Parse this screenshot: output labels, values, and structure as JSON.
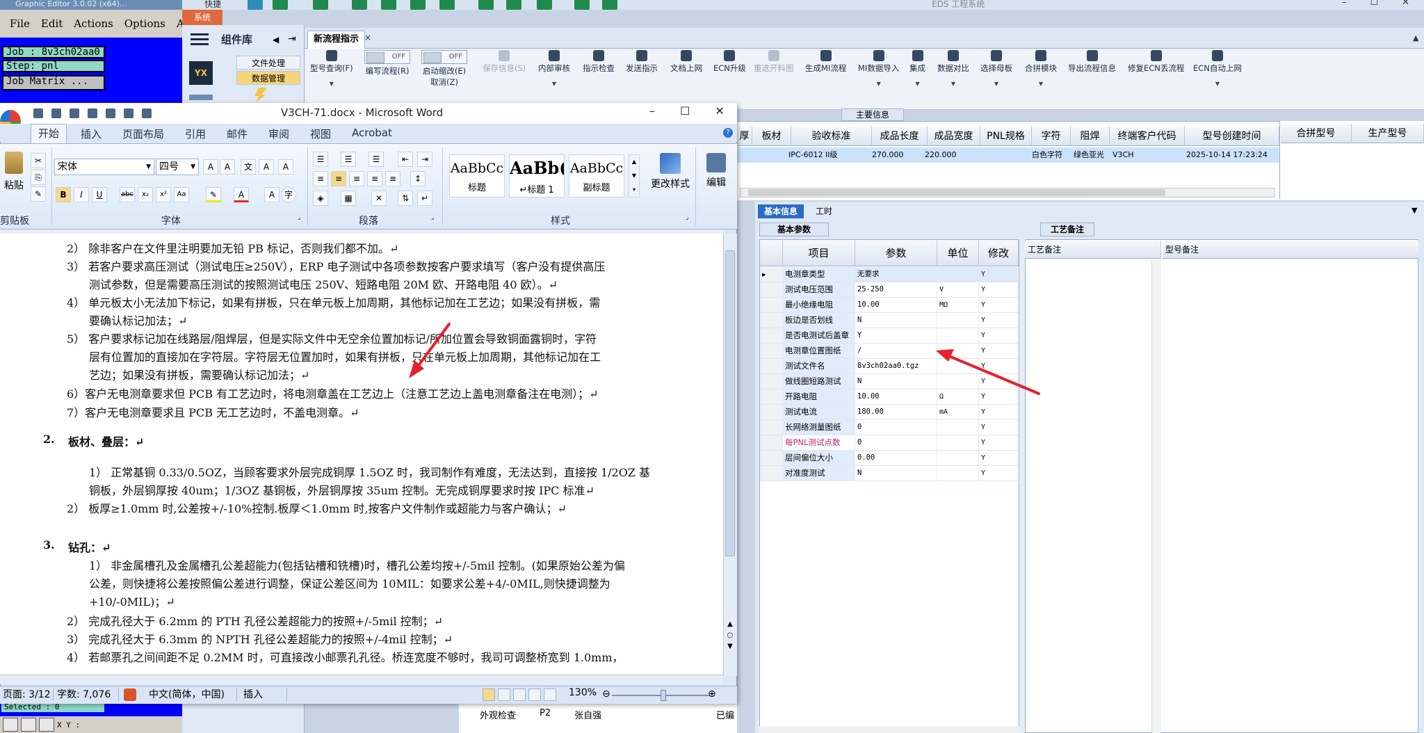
{
  "graphic_editor": {
    "title": "Graphic Editor 3.0.02 (x64)…",
    "menu": [
      "File",
      "Edit",
      "Actions",
      "Options",
      "Anal"
    ],
    "job_label": "Job : 8v3ch02aa0",
    "step_label": "Step: pnl",
    "job_matrix_label": "Job Matrix ...",
    "selected_label": "Selected : 0",
    "xy_label": "X Y :"
  },
  "outer_app": {
    "quick_access_label": "快捷",
    "title": "EDS 工程系统",
    "window_controls": [
      "–",
      "☐",
      "✕"
    ]
  },
  "left_nav": {
    "system_tab": "系统",
    "header": "组件库",
    "items": [
      "文件处理",
      "数据管理"
    ]
  },
  "eng_app": {
    "tab_label": "新流程指示",
    "tab_close": "×",
    "ribbon": [
      {
        "label": "型号查询(F)",
        "enabled": true
      },
      {
        "label": "编写流程(R)",
        "toggle": "OFF",
        "enabled": true
      },
      {
        "label": "启动缩改(E)",
        "label2": "取消(Z)",
        "toggle": "OFF",
        "enabled": true
      },
      {
        "label": "保存信息(S)",
        "enabled": false
      },
      {
        "label": "内部审核",
        "enabled": true
      },
      {
        "label": "指示检查",
        "enabled": true
      },
      {
        "label": "发送指示",
        "enabled": true
      },
      {
        "label": "文档上网",
        "enabled": true
      },
      {
        "label": "ECN升级",
        "enabled": true
      },
      {
        "label": "重选开料图",
        "enabled": false
      },
      {
        "label": "生成MI流程",
        "enabled": true
      },
      {
        "label": "MI数据导入",
        "enabled": true
      },
      {
        "label": "集成",
        "enabled": true
      },
      {
        "label": "数据对比",
        "enabled": true
      },
      {
        "label": "选择母板",
        "enabled": true
      },
      {
        "label": "合拼模块",
        "enabled": true
      },
      {
        "label": "导出流程信息",
        "enabled": true
      },
      {
        "label": "修复ECN丢流程",
        "enabled": true
      },
      {
        "label": "ECN自动上网",
        "enabled": true
      }
    ],
    "main_info_label": "主要信息",
    "grid_columns": [
      "厚",
      "板材",
      "验收标准",
      "成品长度",
      "成品宽度",
      "PNL规格",
      "字符",
      "阻焊",
      "终端客户代码",
      "型号创建时间"
    ],
    "grid_row": {
      "standard": "IPC-6012 II级",
      "length": "270.000",
      "width": "220.000",
      "legend": "白色字符",
      "mask": "绿色亚光",
      "customer": "V3CH",
      "created": "2025-10-14 17:23:24"
    },
    "side_columns": [
      "合拼型号",
      "生产型号"
    ]
  },
  "lower": {
    "tab_basic": "基本信息",
    "tab_hours": "工时",
    "sub_basic": "基本参数",
    "sub_notes": "工艺备注",
    "param_headers": [
      "项目",
      "参数",
      "单位",
      "修改"
    ],
    "params": [
      {
        "name": "电测章类型",
        "value": "无要求",
        "unit": "",
        "mod": "Y"
      },
      {
        "name": "测试电压范围",
        "value": "25-250",
        "unit": "V",
        "mod": "Y"
      },
      {
        "name": "最小绝缘电阻",
        "value": "10.00",
        "unit": "MΩ",
        "mod": "Y"
      },
      {
        "name": "板边是否划线",
        "value": "N",
        "unit": "",
        "mod": "Y"
      },
      {
        "name": "是否电测试后盖章",
        "value": "Y",
        "unit": "",
        "mod": "Y"
      },
      {
        "name": "电测章位置图纸",
        "value": "/",
        "unit": "",
        "mod": "Y"
      },
      {
        "name": "测试文件名",
        "value": "8v3ch02aa0.tgz",
        "unit": "",
        "mod": "Y"
      },
      {
        "name": "做线圈短路测试",
        "value": "N",
        "unit": "",
        "mod": "Y"
      },
      {
        "name": "开路电阻",
        "value": "10.00",
        "unit": "Ω",
        "mod": "Y"
      },
      {
        "name": "测试电流",
        "value": "180.00",
        "unit": "mA",
        "mod": "Y"
      },
      {
        "name": "长网络测量图纸",
        "value": "0",
        "unit": "",
        "mod": "Y"
      },
      {
        "name": "每PNL测试点数",
        "value": "0",
        "unit": "",
        "mod": "Y"
      },
      {
        "name": "层间偏位大小",
        "value": "0.00",
        "unit": "",
        "mod": "Y"
      },
      {
        "name": "对准度测试",
        "value": "N",
        "unit": "",
        "mod": "Y"
      }
    ],
    "notes_headers": [
      "工艺备注",
      "型号备注"
    ],
    "under_row": {
      "name": "外观检查",
      "code": "P2",
      "person": "张自强",
      "status": "已编"
    }
  },
  "word": {
    "title": "V3CH-71.docx - Microsoft Word",
    "tabs": [
      "开始",
      "插入",
      "页面布局",
      "引用",
      "邮件",
      "审阅",
      "视图",
      "Acrobat"
    ],
    "font_name": "宋体",
    "font_size": "四号",
    "group_labels": [
      "剪贴板",
      "字体",
      "段落",
      "样式"
    ],
    "paste_label": "粘贴",
    "styles": [
      {
        "preview": "AaBbCc",
        "name": "标题"
      },
      {
        "preview": "AaBb(",
        "name": "↵标题 1"
      },
      {
        "preview": "AaBbCc",
        "name": "副标题"
      }
    ],
    "change_styles": "更改样式",
    "edit_label": "编辑",
    "status": {
      "page": "页面: 3/12",
      "words": "字数: 7,076",
      "lang": "中文(简体，中国)",
      "mode": "插入",
      "zoom": "130%"
    },
    "lines": [
      "2）  除非客户在文件里注明要加无铅 PB 标记，否则我们都不加。↵",
      "3）  若客户要求高压测试（测试电压≥250V），ERP 电子测试中各项参数按客户要求填写（客户没有提供高压",
      "测试参数，但是需要高压测试的按照测试电压 250V、短路电阻 20M 欧、开路电阻 40 欧）。↵",
      "4）  单元板太小无法加下标记，如果有拼板，只在单元板上加周期，其他标记加在工艺边；如果没有拼板，需",
      "要确认标记加法；↵",
      "5）  客户要求标记加在线路层/阻焊层，但是实际文件中无空余位置加标记/所加位置会导致铜面露铜时，字符",
      "层有位置加的直接加在字符层。字符层无位置加时，如果有拼板，只在单元板上加周期，其他标记加在工",
      "艺边；如果没有拼板，需要确认标记加法；↵",
      "6）客户无电测章要求但 PCB 有工艺边时，将电测章盖在工艺边上（注意工艺边上盖电测章备注在电测）；↵",
      "7）客户无电测章要求且 PCB 无工艺边时，不盖电测章。↵",
      "1）  正常基铜 0.33/0.5OZ，当顾客要求外层完成铜厚 1.5OZ 时，我司制作有难度，无法达到，直接按 1/2OZ 基",
      "铜板，外层铜厚按 40um；1/3OZ 基铜板，外层铜厚按 35um 控制。无完成铜厚要求时按 IPC 标准↵",
      "2）  板厚≥1.0mm 时,公差按+/-10%控制.板厚＜1.0mm 时,按客户文件制作或超能力与客户确认；↵",
      "1）  非金属槽孔及金属槽孔公差超能力(包括钻槽和铣槽)时，槽孔公差均按+/-5mil 控制。(如果原始公差为偏",
      "公差，则快捷将公差按照偏公差进行调整，保证公差区间为 10MIL：如要求公差+4/-0MIL,则快捷调整为",
      "+10/-0MIL)；↵",
      "2）  完成孔径大于 6.2mm 的 PTH 孔径公差超能力的按照+/-5mil 控制；↵",
      "3）  完成孔径大于 6.3mm 的 NPTH 孔径公差超能力的按照+/-4mil 控制；↵",
      "4）  若邮票孔之间间距不足 0.2MM 时，可直接改小邮票孔孔径。桥连宽度不够时，我司可调整桥宽到 1.0mm，"
    ],
    "headings": [
      {
        "num": "2.",
        "text": "板材、叠层：↵"
      },
      {
        "num": "3.",
        "text": "钻孔：↵"
      }
    ]
  },
  "colors": {
    "annotation_arrow": "#e8202a",
    "word_tab_bg": "#dbe7f6",
    "eng_accent": "#2b6cc4"
  }
}
